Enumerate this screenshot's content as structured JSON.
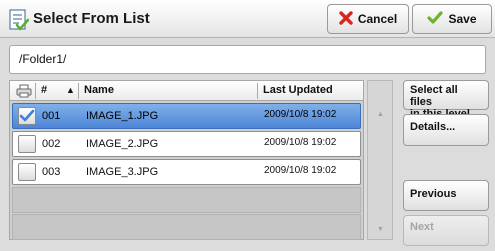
{
  "header": {
    "title": "Select From List",
    "cancel_label": "Cancel",
    "save_label": "Save"
  },
  "path": "/Folder1/",
  "list": {
    "columns": {
      "num": "#",
      "name": "Name",
      "last_updated": "Last Updated"
    },
    "sort_indicator": "▲",
    "rows": [
      {
        "num": "001",
        "name": "IMAGE_1.JPG",
        "date": "2009/10/8 19:02",
        "selected": true
      },
      {
        "num": "002",
        "name": "IMAGE_2.JPG",
        "date": "2009/10/8 19:02",
        "selected": false
      },
      {
        "num": "003",
        "name": "IMAGE_3.JPG",
        "date": "2009/10/8 19:02",
        "selected": false
      }
    ]
  },
  "scroll": {
    "up": "▲",
    "down": "▼"
  },
  "side": {
    "select_all_line1": "Select all files",
    "select_all_line2": "in this level",
    "details_label": "Details...",
    "previous_label": "Previous",
    "next_label": "Next"
  },
  "colors": {
    "selection": "#5a8fdb",
    "cancel_icon": "#d9251d",
    "save_icon": "#6fb52c"
  },
  "icons": {
    "title": "list-document-check-icon",
    "cancel": "cross-icon",
    "save": "checkmark-icon",
    "column": "printer-icon"
  }
}
